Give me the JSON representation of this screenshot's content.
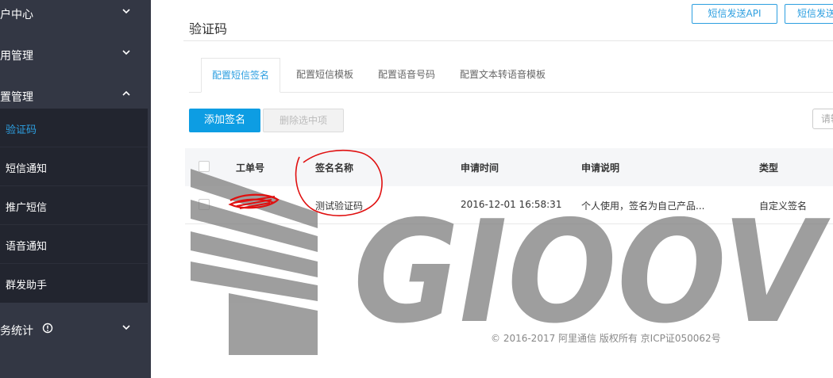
{
  "sidebar": {
    "groups": [
      {
        "label": "户中心",
        "chevron": "chevron-down-icon"
      },
      {
        "label": "用管理",
        "chevron": "chevron-down-icon"
      },
      {
        "label": "置管理",
        "chevron": "chevron-up-icon"
      },
      {
        "label": "务统计",
        "chevron": "chevron-down-icon"
      }
    ],
    "sub_items": [
      {
        "label": "验证码",
        "active": true
      },
      {
        "label": "短信通知"
      },
      {
        "label": "推广短信"
      },
      {
        "label": "语音通知"
      },
      {
        "label": "群发助手"
      }
    ],
    "colors": {
      "background": "#333744",
      "submenu": "#22252f",
      "active": "#2d9fe0"
    }
  },
  "header": {
    "title": "验证码",
    "buttons": [
      "短信发送API",
      "短信发送"
    ]
  },
  "tabs": [
    "配置短信签名",
    "配置短信模板",
    "配置语音号码",
    "配置文本转语音模板"
  ],
  "toolbar": {
    "add_label": "添加签名",
    "delete_label": "删除选中项",
    "search_placeholder": "请输"
  },
  "table": {
    "columns": [
      "工单号",
      "签名名称",
      "申请时间",
      "申请说明",
      "类型"
    ],
    "rows": [
      {
        "order_no": "",
        "name": "测试验证码",
        "time": "2016-12-01 16:58:31",
        "note": "个人使用，签名为自己产品...",
        "type": "自定义签名"
      }
    ]
  },
  "footer": {
    "text": "© 2016-2017 阿里通信 版权所有 京ICP证050062号"
  },
  "watermark": {
    "text": "GIOOV",
    "color": "#7a7a7a"
  },
  "annotation_color": "#e01010",
  "accent": "#0d9de3"
}
